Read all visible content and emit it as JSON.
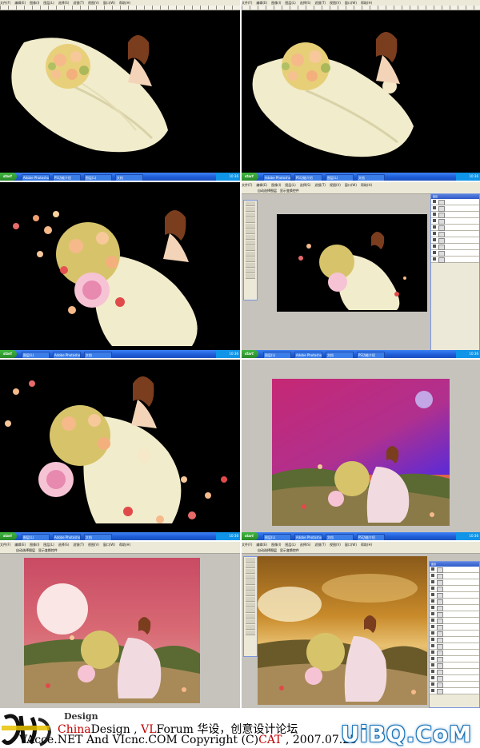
{
  "menu": [
    "文件(F)",
    "编辑(E)",
    "图像(I)",
    "图层(L)",
    "选择(S)",
    "滤镜(T)",
    "视图(V)",
    "窗口(W)",
    "帮助(H)"
  ],
  "taskbar": {
    "start": "start",
    "tasks": [
      "Adobe Photoshop",
      "PS功能介绍",
      "图层(L)",
      "文档",
      "CAT"
    ],
    "clock": "10:36"
  },
  "options": {
    "text1": "自动选择图层",
    "text2": "显示变换控件"
  },
  "layers_title": "图层",
  "footer": {
    "design_label": "Design",
    "line1_china": "China",
    "line1_design": "Design , ",
    "line1_vl": "VL",
    "line1_forum": "Forum  华设，创意设计论坛",
    "line2_a": "VAcce.NET   And   VIcnc.COM    Copyright (C)",
    "line2_cat": "CAT",
    "line2_date": " , 2007.07.25"
  },
  "watermark": "UiBQ.CoM",
  "colors": {
    "taskbar": "#1d5bd6",
    "accent_red": "#c00000",
    "watermark": "#1a73b8"
  }
}
